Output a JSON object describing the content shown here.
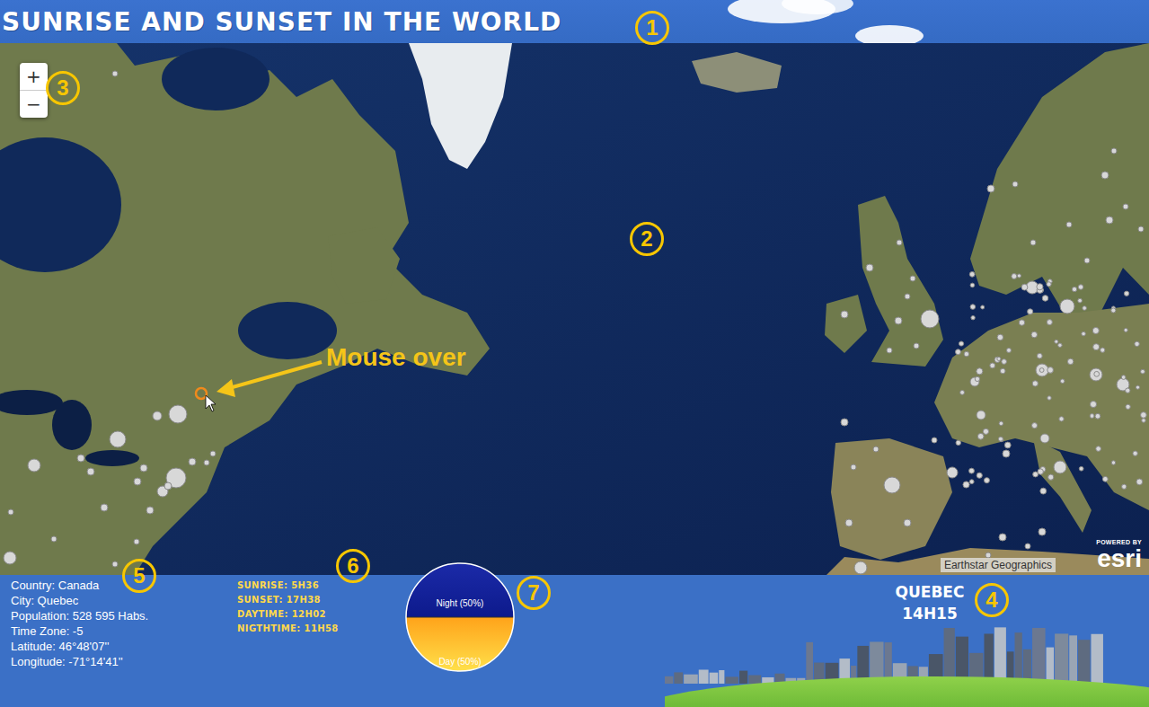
{
  "header": {
    "title": "SUNRISE AND SUNSET IN THE WORLD"
  },
  "map": {
    "zoom_in": "+",
    "zoom_out": "−",
    "attribution": "Earthstar Geographics",
    "logo": {
      "caption": "POWERED BY",
      "name": "esri"
    },
    "hover_marker": {
      "hovered": true
    }
  },
  "callout": {
    "label": "Mouse over"
  },
  "annotations": [
    "1",
    "2",
    "3",
    "4",
    "5",
    "6",
    "7"
  ],
  "city_info": [
    "Country: Canada",
    "City: Quebec",
    "Population: 528 595 Habs.",
    "Time Zone: -5",
    "Latitude: 46°48'07''",
    "Longitude: -71°14'41''"
  ],
  "sun_times": [
    "SUNRISE: 5H36",
    "SUNSET: 17H38",
    "DAYTIME: 12H02",
    "NIGTHTIME: 11H58"
  ],
  "day_chart": {
    "slices": [
      {
        "label": "Night (50%)",
        "value": 50,
        "color": "#0d1a8c"
      },
      {
        "label": "Day (50%)",
        "value": 50,
        "color": "#ffa31a"
      }
    ]
  },
  "clock": {
    "city": "QUEBEC",
    "time": "14H15"
  }
}
